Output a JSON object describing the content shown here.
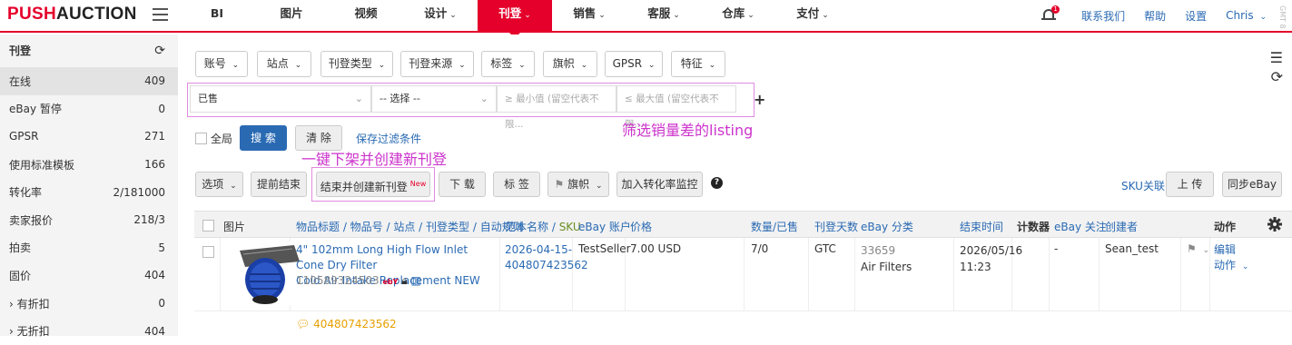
{
  "brand": {
    "part1": "PUSH",
    "part2": "AUCTION"
  },
  "nav": [
    {
      "label": "BI",
      "caret": false,
      "active": false
    },
    {
      "label": "图片",
      "caret": false,
      "active": false
    },
    {
      "label": "视频",
      "caret": false,
      "active": false
    },
    {
      "label": "设计",
      "caret": true,
      "active": false
    },
    {
      "label": "刊登",
      "caret": true,
      "active": true
    },
    {
      "label": "销售",
      "caret": true,
      "active": false
    },
    {
      "label": "客服",
      "caret": true,
      "active": false
    },
    {
      "label": "仓库",
      "caret": true,
      "active": false
    },
    {
      "label": "支付",
      "caret": true,
      "active": false
    }
  ],
  "top_right": {
    "notification_count": "1",
    "contact": "联系我们",
    "help": "帮助",
    "settings": "设置",
    "user": "Chris",
    "vertical_text": "GMT 8"
  },
  "sidebar": {
    "title": "刊登",
    "items": [
      {
        "label": "在线",
        "count": "409"
      },
      {
        "label": "eBay 暂停",
        "count": "0"
      },
      {
        "label": "GPSR",
        "count": "271"
      },
      {
        "label": "使用标准模板",
        "count": "166"
      },
      {
        "label": "转化率",
        "count": "2/181000"
      },
      {
        "label": "卖家报价",
        "count": "218/3"
      },
      {
        "label": "拍卖",
        "count": "5"
      },
      {
        "label": "固价",
        "count": "404"
      },
      {
        "label": "› 有折扣",
        "count": "0"
      },
      {
        "label": "› 无折扣",
        "count": "404"
      }
    ]
  },
  "filters": {
    "buttons": [
      "账号",
      "站点",
      "刊登类型",
      "刊登来源",
      "标签",
      "旗帜",
      "GPSR",
      "特征"
    ],
    "field_value": "已售",
    "operator_value": "-- 选择 --",
    "min_placeholder": "≥ 最小值 (留空代表不限...",
    "max_placeholder": "≤ 最大值 (留空代表不限...",
    "all_label": "全局",
    "search": "搜 索",
    "clear": "清 除",
    "save": "保存过滤条件"
  },
  "annotations": {
    "filter_note": "筛选销量差的listing",
    "action_note": "一键下架并创建新刊登"
  },
  "toolbar": {
    "options": "选项",
    "end_early": "提前结束",
    "end_and_create": "结束并创建新刊登",
    "new_badge": "New",
    "download": "下 载",
    "tag": "标 签",
    "flag": "旗帜",
    "add_monitor": "加入转化率监控",
    "help": "?",
    "sku_link": "SKU关联",
    "upload": "上 传",
    "sync": "同步eBay"
  },
  "table": {
    "headers": {
      "image": "图片",
      "title_group": "物品标题 / 物品号 / 站点 / 刊登类型 / 自动规则",
      "template_sku_a": "范本名称 / ",
      "template_sku_b": "SKU",
      "account": "eBay 账户",
      "price": "价格",
      "qty": "数量/已售",
      "days": "刊登天数",
      "category": "eBay 分类",
      "end_time": "结束时间",
      "counter": "计数器",
      "watch": "eBay 关注",
      "creator": "创建者",
      "action": "动作"
    },
    "row": {
      "title": "4\" 102mm Long High Flow Inlet Cone Dry Filter Cold Air Intake Replacement NEW",
      "title_line1": "4\" 102mm Long High Flow Inlet Cone Dry Filter",
      "title_line2": "Cold Air Intake Replacement NEW",
      "item_no": "110589324503",
      "template": "2026-04-15-404807423562",
      "template_line1": "2026-04-15-",
      "template_line2": "404807423562",
      "account": "TestSeller",
      "price": "7.00 USD",
      "qty": "7/0",
      "days": "GTC",
      "cat_id": "33659",
      "cat_name": "Air Filters",
      "end_date": "2026/05/16",
      "end_time": "11:23",
      "counter": "-",
      "watch": "-",
      "creator": "Sean_test",
      "edit": "编辑",
      "action": "动作"
    },
    "sub_row": "404807423562"
  }
}
